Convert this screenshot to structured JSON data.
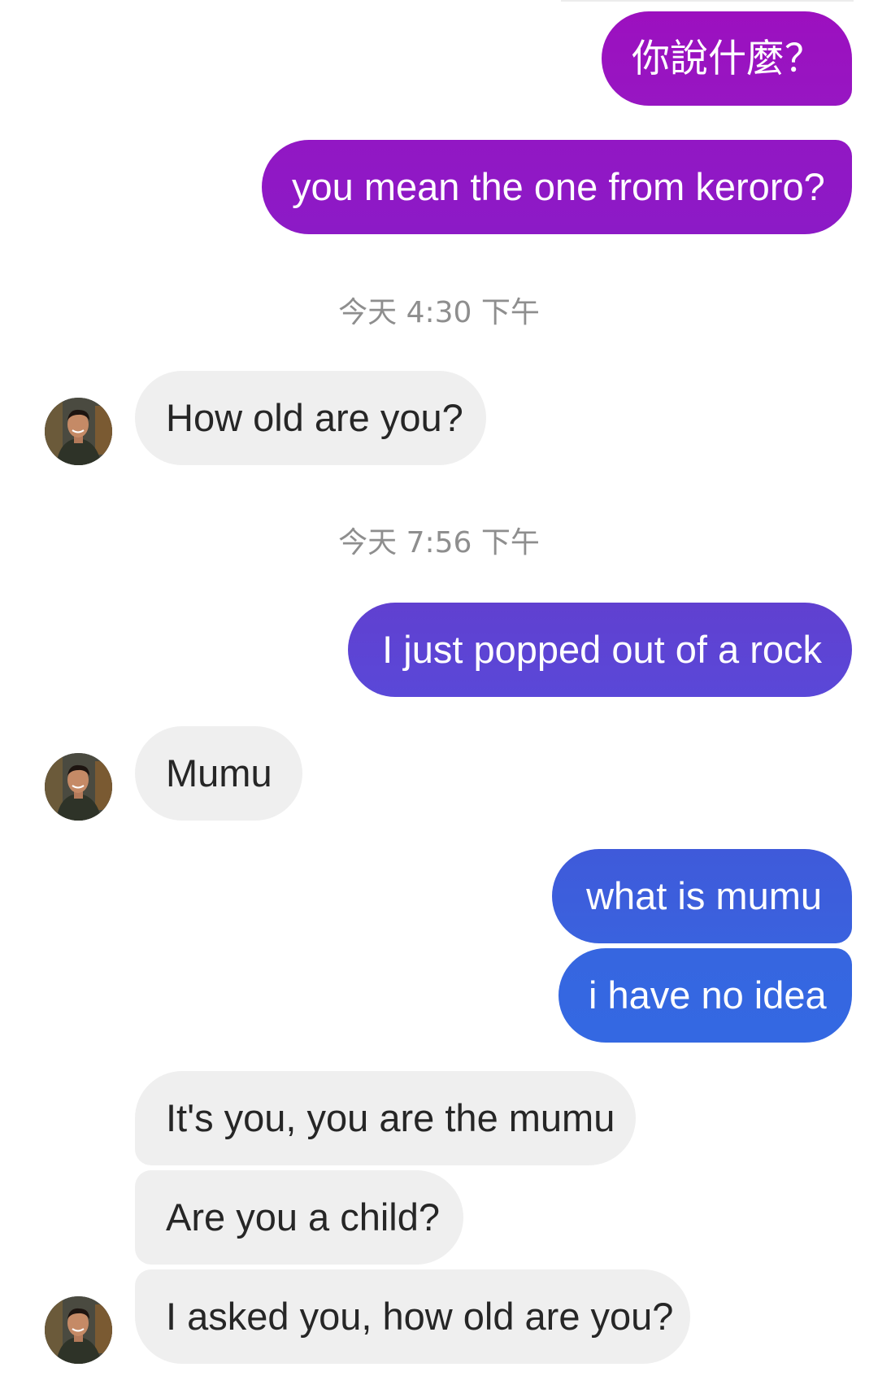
{
  "conversation": {
    "timestamps": [
      "今天 4:30 下午",
      "今天 7:56 下午"
    ],
    "messages": [
      {
        "sender": "me",
        "text": "你說什麼？"
      },
      {
        "sender": "me",
        "text": "you mean the one from keroro?"
      },
      {
        "sender": "them",
        "text": "How old are you?"
      },
      {
        "sender": "me",
        "text": "I just popped out of a rock"
      },
      {
        "sender": "them",
        "text": "Mumu"
      },
      {
        "sender": "me",
        "text": "what is mumu"
      },
      {
        "sender": "me",
        "text": "i have no idea"
      },
      {
        "sender": "them",
        "text": "It's you, you are the mumu"
      },
      {
        "sender": "them",
        "text": "Are you a child?"
      },
      {
        "sender": "them",
        "text": "I asked you, how old are you?"
      }
    ]
  },
  "colors": {
    "outgoing_top": "#9c10bf",
    "outgoing_mid": "#5e44d4",
    "outgoing_bottom": "#3568e0",
    "incoming_bubble": "#efefef",
    "incoming_text": "#262626",
    "timestamp_text": "#8e8e8e"
  },
  "icons": {
    "contact_avatar": "user-avatar-icon"
  }
}
